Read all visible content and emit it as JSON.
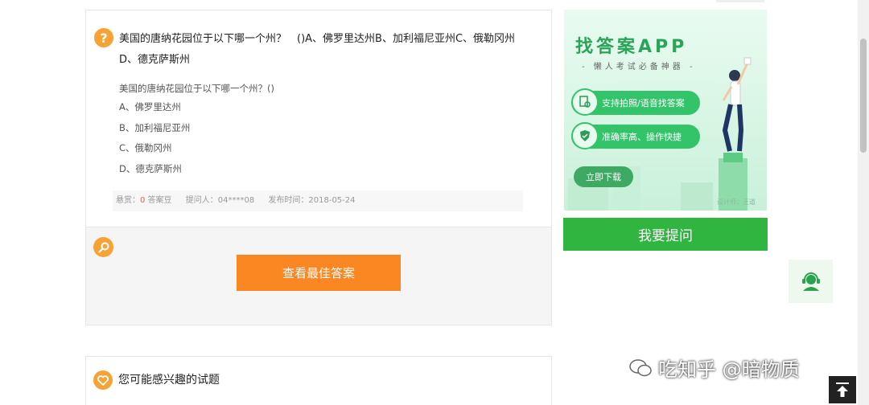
{
  "question": {
    "title": "美国的唐纳花园位于以下哪一个州？　()A、佛罗里达州B、加利福尼亚州C、俄勒冈州D、德克萨斯州",
    "stem": "美国的唐纳花园位于以下哪一个州？()",
    "options": [
      "A、佛罗里达州",
      "B、加利福尼亚州",
      "C、俄勒冈州",
      "D、德克萨斯州"
    ],
    "meta": {
      "reward_label": "悬赏：",
      "reward_value": "0",
      "reward_unit": " 答案豆",
      "asker_label": "提问人：",
      "asker_value": "04****08",
      "date_label": "发布时间：",
      "date_value": "2018-05-24"
    },
    "view_answer_label": "查看最佳答案"
  },
  "related": {
    "title": "您可能感兴趣的试题"
  },
  "ad": {
    "title": "找答案APP",
    "subtitle": "- 懒人考试必备神器 -",
    "features": [
      "支持拍照/语音找答案",
      "准确率高、操作快捷"
    ],
    "download_label": "立即下载",
    "credit": "设计师：王道"
  },
  "sidebar": {
    "ask_label": "我要提问"
  },
  "watermark": {
    "text": "吃知乎 @暗物质"
  },
  "colors": {
    "accent_orange": "#fb8722",
    "icon_orange": "#f7a234",
    "green": "#2fb540"
  }
}
